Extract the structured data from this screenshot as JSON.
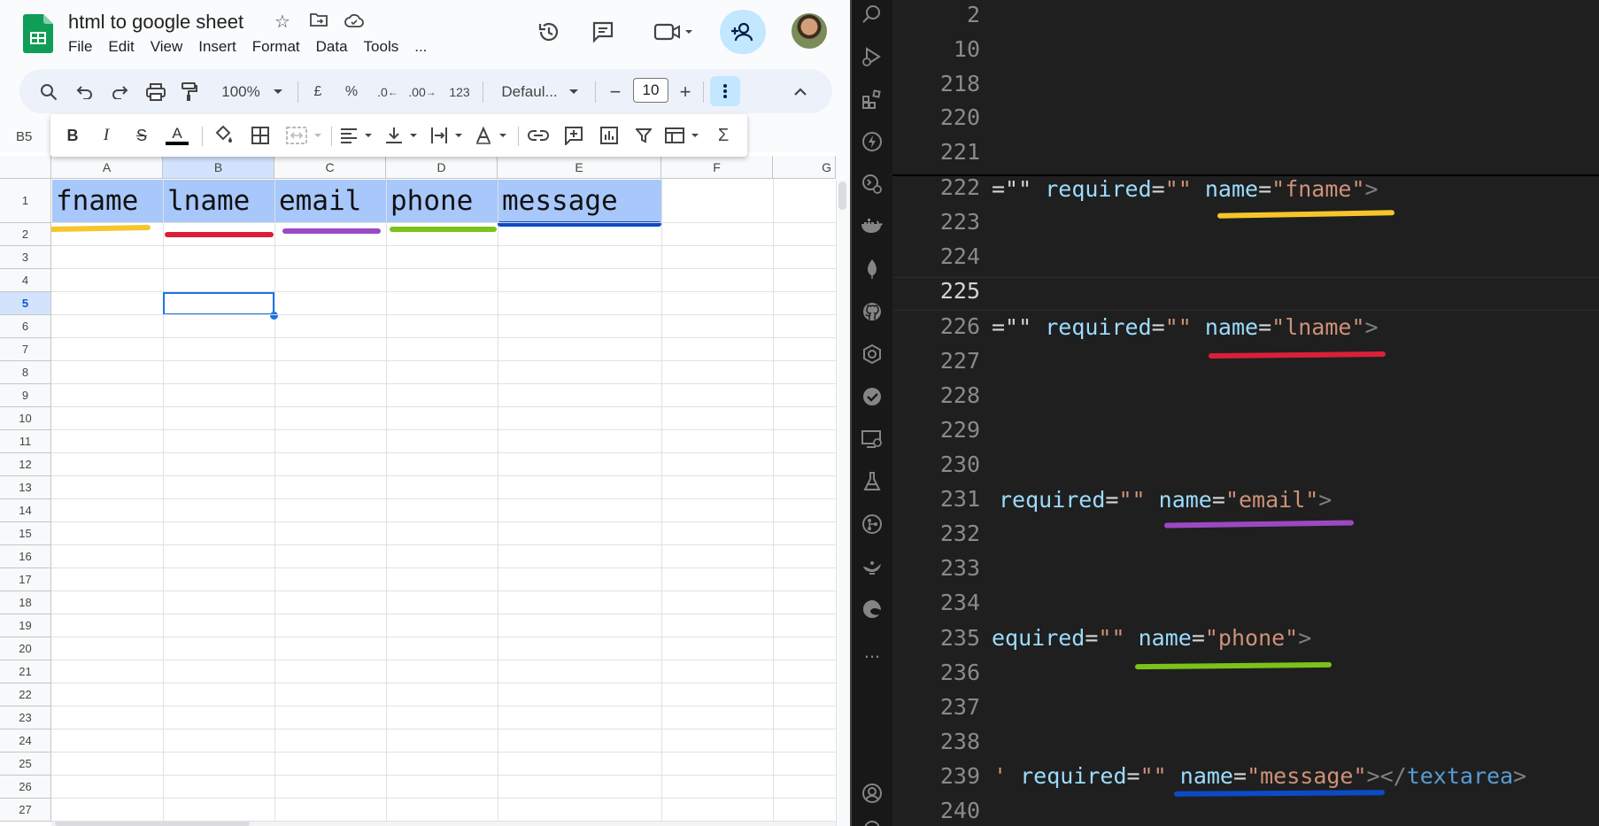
{
  "sheets": {
    "title": "html to google sheet",
    "menu": [
      "File",
      "Edit",
      "View",
      "Insert",
      "Format",
      "Data",
      "Tools",
      "..."
    ],
    "toolbar": {
      "zoom": "100%",
      "currency": "£",
      "percent": "%",
      "dec_decrease": ".0",
      "dec_increase": ".00",
      "number_format": "123",
      "font": "Defaul...",
      "font_size": "10"
    },
    "name_box": "B5",
    "columns": [
      "A",
      "B",
      "C",
      "D",
      "E",
      "F",
      "G"
    ],
    "rows": [
      "1",
      "2",
      "3",
      "4",
      "5",
      "6",
      "7",
      "8",
      "9",
      "10",
      "11",
      "12",
      "13",
      "14",
      "15",
      "16",
      "17",
      "18",
      "19",
      "20",
      "21",
      "22",
      "23",
      "24",
      "25",
      "26",
      "27"
    ],
    "header_cells": [
      "fname",
      "lname",
      "email",
      "phone",
      "message"
    ],
    "underline_colors": [
      "#f7c52b",
      "#d9203a",
      "#9b49c2",
      "#7cc21a",
      "#0b4bc4"
    ],
    "selected_cell": "B5"
  },
  "editor": {
    "line_numbers": [
      "2",
      "10",
      "218",
      "220",
      "221",
      "222",
      "223",
      "224",
      "225",
      "226",
      "227",
      "228",
      "229",
      "230",
      "231",
      "232",
      "233",
      "234",
      "235",
      "236",
      "237",
      "238",
      "239",
      "240"
    ],
    "active_line": "225",
    "lines": {
      "l222": {
        "lead": "=\"\"",
        "attr": "required",
        "eq": "=",
        "val": "\"\"",
        "name_attr": "name",
        "name_eq": "=",
        "name_val": "\"fname\"",
        "close": ">"
      },
      "l226": {
        "lead": "=\"\"",
        "attr": "required",
        "eq": "=",
        "val": "\"\"",
        "name_attr": "name",
        "name_eq": "=",
        "name_val": "\"lname\"",
        "close": ">"
      },
      "l231": {
        "attr": "required",
        "eq": "=",
        "val": "\"\"",
        "name_attr": "name",
        "name_eq": "=",
        "name_val": "\"email\"",
        "close": ">"
      },
      "l235": {
        "attr": "equired",
        "eq": "=",
        "val": "\"\"",
        "name_attr": "name",
        "name_eq": "=",
        "name_val": "\"phone\"",
        "close": ">"
      },
      "l239": {
        "lead": "'",
        "attr": "required",
        "eq": "=",
        "val": "\"\"",
        "name_attr": "name",
        "name_eq": "=",
        "name_val": "\"message\"",
        "close": "></",
        "tag": "textarea",
        "tag_close": ">"
      }
    },
    "more_label": "..."
  }
}
